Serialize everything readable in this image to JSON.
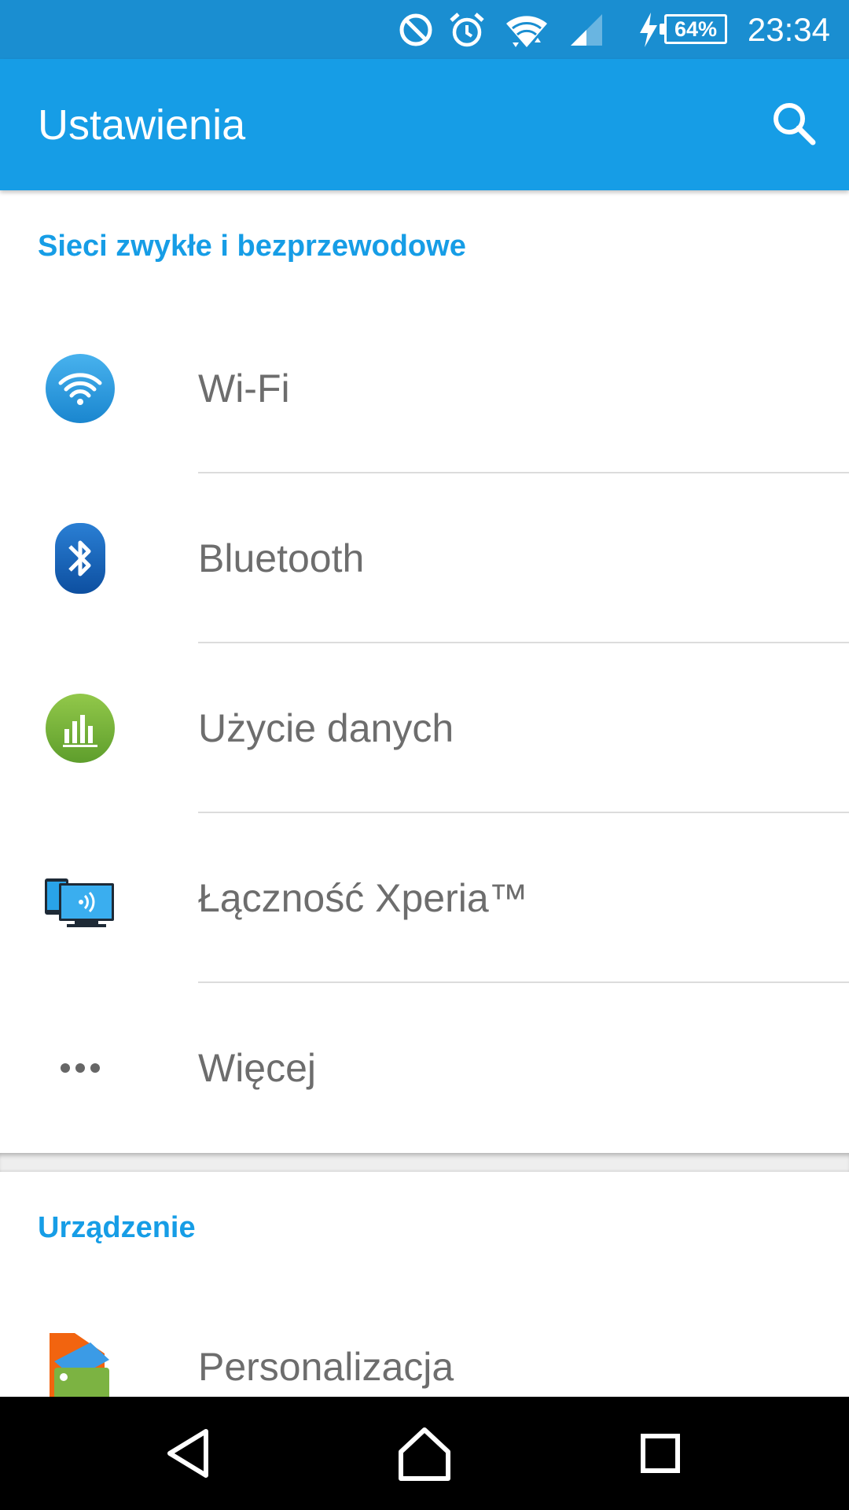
{
  "status_bar": {
    "time": "23:34",
    "battery_percent": "64%",
    "icons": [
      "do-not-disturb-icon",
      "alarm-icon",
      "wifi-signal-icon",
      "cell-signal-icon",
      "charging-bolt-icon",
      "battery-icon"
    ]
  },
  "app_bar": {
    "title": "Ustawienia",
    "search_icon": "search-icon"
  },
  "sections": [
    {
      "header": "Sieci zwykłe i bezprzewodowe",
      "items": [
        {
          "label": "Wi-Fi",
          "icon": "wifi-icon",
          "icon_color": "#2196d8"
        },
        {
          "label": "Bluetooth",
          "icon": "bluetooth-icon",
          "icon_color": "#1565c0"
        },
        {
          "label": "Użycie danych",
          "icon": "data-usage-icon",
          "icon_color": "#7cb342"
        },
        {
          "label": "Łączność Xperia™",
          "icon": "xperia-connectivity-icon",
          "icon_color": "#29a3e8"
        },
        {
          "label": "Więcej",
          "icon": "more-dots-icon",
          "icon_color": "#666666"
        }
      ]
    },
    {
      "header": "Urządzenie",
      "items": [
        {
          "label": "Personalizacja",
          "icon": "personalization-icon",
          "icon_color": "#ff6f00"
        }
      ]
    }
  ],
  "nav_bar": {
    "back": "back-icon",
    "home": "home-icon",
    "recents": "recents-icon"
  },
  "colors": {
    "status_bar": "#1a8ed1",
    "app_bar": "#169de6",
    "accent": "#169de6",
    "label_text": "#6d6d6d"
  }
}
